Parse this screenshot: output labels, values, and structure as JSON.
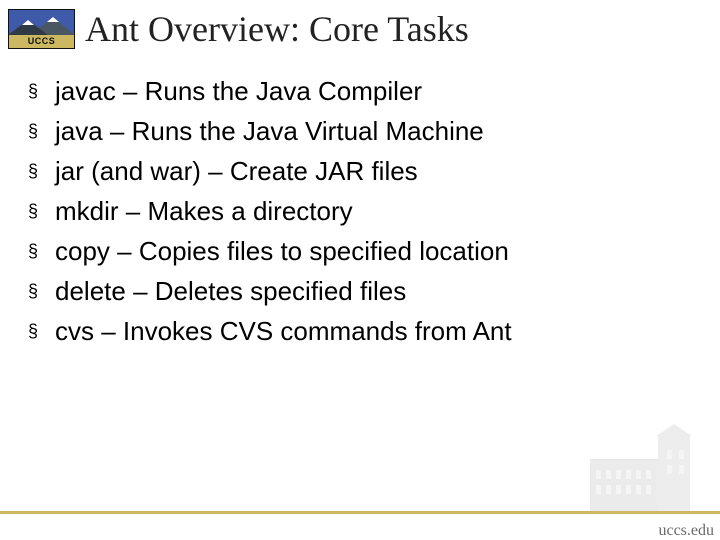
{
  "logo_text": "UCCS",
  "title": "Ant Overview: Core Tasks",
  "bullets": [
    "javac – Runs the Java Compiler",
    "java – Runs the Java Virtual Machine",
    "jar (and war) – Create JAR files",
    "mkdir – Makes a directory",
    "copy – Copies files to specified location",
    "delete – Deletes specified files",
    "cvs – Invokes CVS commands from Ant"
  ],
  "bullet_char": "§",
  "footer_url": "uccs.edu"
}
